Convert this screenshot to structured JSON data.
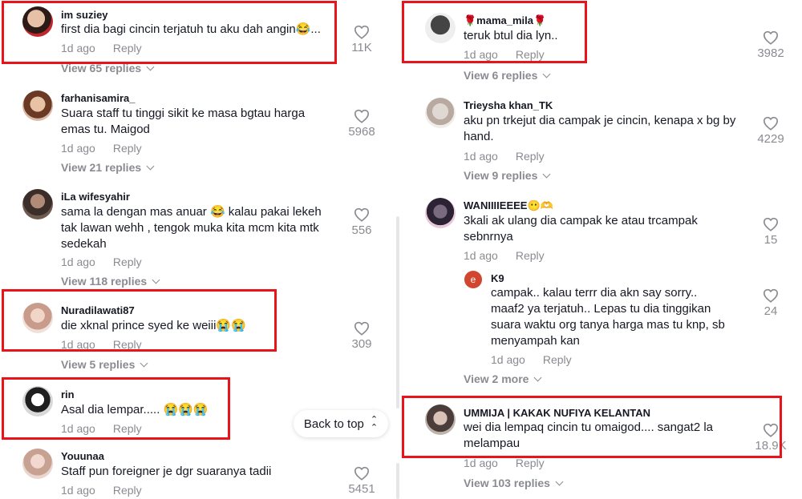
{
  "left": [
    {
      "user": "im suziey",
      "text": "first dia bagi cincin terjatuh tu aku dah angin😂...",
      "time": "1d ago",
      "reply": "Reply",
      "likes": "11K",
      "view": "View 65 replies"
    },
    {
      "user": "farhanisamira_",
      "text": "Suara staff tu tinggi sikit ke masa bgtau harga emas tu. Maigod",
      "time": "1d ago",
      "reply": "Reply",
      "likes": "5968",
      "view": "View 21 replies"
    },
    {
      "user": "iLa wifesyahir",
      "text": "sama la dengan mas anuar 😂 kalau pakai lekeh tak lawan wehh , tengok muka kita mcm kita mtk sedekah",
      "time": "1d ago",
      "reply": "Reply",
      "likes": "556",
      "view": "View 118 replies"
    },
    {
      "user": "Nuradilawati87",
      "text": "die xknal prince syed ke weiii😭😭",
      "time": "1d ago",
      "reply": "Reply",
      "likes": "309",
      "view": "View 5 replies"
    },
    {
      "user": "rin",
      "text": "Asal dia lempar..... 😭😭😭",
      "time": "1d ago",
      "reply": "Reply",
      "likes": "",
      "view": ""
    },
    {
      "user": "Youunaa",
      "text": "Staff pun foreigner je dgr suaranya tadii",
      "time": "1d ago",
      "reply": "Reply",
      "likes": "5451",
      "view": ""
    }
  ],
  "right": [
    {
      "user": "🌹mama_mila🌹",
      "text": "teruk btul dia lyn..",
      "time": "1d ago",
      "reply": "Reply",
      "likes": "3982",
      "view": "View 6 replies"
    },
    {
      "user": "Trieysha khan_TK",
      "text": "aku pn trkejut dia campak je cincin, kenapa x bg by hand.",
      "time": "1d ago",
      "reply": "Reply",
      "likes": "4229",
      "view": "View 9 replies"
    },
    {
      "user": "WANIIIIEEEE😶🫶",
      "text": "3kali ak ulang dia campak ke atau trcampak sebnrnya",
      "time": "1d ago",
      "reply": "Reply",
      "likes": "15",
      "view": ""
    },
    {
      "user": "K9",
      "text": "campak.. kalau terrr dia akn say sorry.. maaf2 ya terjatuh.. Lepas tu dia tinggikan suara waktu org tanya harga mas tu knp, sb menyampah kan",
      "time": "1d ago",
      "reply": "Reply",
      "likes": "24",
      "view": "View 2 more",
      "avatar_letter": "e"
    },
    {
      "user": "UMMIJA | KAKAK NUFIYA KELANTAN",
      "text": "wei dia lempaq cincin tu omaigod.... sangat2 la melampau",
      "time": "1d ago",
      "reply": "Reply",
      "likes": "18.9K",
      "view": "View 103 replies"
    }
  ],
  "back_to_top": "Back to top",
  "colors": {
    "highlight": "#e8141a",
    "muted": "#8a8b91",
    "text": "#161823"
  }
}
